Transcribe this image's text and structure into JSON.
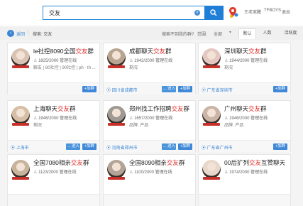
{
  "search": {
    "value": "交友",
    "clear": "×"
  },
  "user": {
    "name": "王老実騰",
    "tag": "TFBOYS",
    "more": "退出"
  },
  "filterbar": {
    "back_label": "返回",
    "crumb_sep": "|",
    "crumb_text": "搜索: 交友",
    "not_found": "搜索不到我的群?",
    "scope_label": "范围:",
    "scope_value": "全部",
    "scope_caret": "▾",
    "tabs": [
      "默认",
      "人数",
      "活跃度"
    ]
  },
  "cards": [
    {
      "title_pre": "le社控8090全国",
      "title_hl": "交友",
      "title_post": "群",
      "stats": "1825/2000  管理在线",
      "tags": "聊友 | 80社控 | 90社控 | ph · th ...",
      "location": "",
      "enter": "",
      "join": "+加群",
      "avatar_color": "#d9c3b3"
    },
    {
      "title_pre": "成都聊天",
      "title_hl": "交友",
      "title_post": "群",
      "stats": "1942/2000  管理在线",
      "tags": "剩况",
      "location": "四川省成都市",
      "enter": "→ 进入",
      "join": "+加群",
      "avatar_color": "#b7a592"
    },
    {
      "title_pre": "深圳聊天",
      "title_hl": "交友",
      "title_post": "群",
      "stats": "1944/2000  管理在线",
      "tags": "剩况",
      "location": "广东省深圳市",
      "enter": "",
      "join": "+加群",
      "avatar_color": "#e3c7c0"
    },
    {
      "title_pre": "上海聊天",
      "title_hl": "交友",
      "title_post": "群",
      "stats": "1946/2000  管理在线",
      "tags": "剩况",
      "location": "上海市",
      "enter": "→ 进入",
      "join": "+加群",
      "avatar_color": "#d7bfa6"
    },
    {
      "title_pre": "郑州找工作招聘",
      "title_hl": "交友",
      "title_post": "群",
      "stats": "1657/2000  管理在线",
      "tags": "品牌, 产品",
      "location": "河南省郑州市",
      "enter": "→ 进入",
      "join": "+加群",
      "avatar_color": "#9e9993"
    },
    {
      "title_pre": "广州聊天",
      "title_hl": "交友",
      "title_post": "群",
      "stats": "1946/2000  管理在线",
      "tags": "品牌, 产品",
      "location": "广东省广州市",
      "enter": "",
      "join": "+加群",
      "avatar_color": "#c9b4a5"
    },
    {
      "title_pre": "全国7080相亲",
      "title_hl": "交友",
      "title_post": "群",
      "stats": "1123/2000  管理在线",
      "tags": "",
      "location": "",
      "enter": "",
      "join": "",
      "avatar_color": "#c8b39d"
    },
    {
      "title_pre": "全国8090相亲",
      "title_hl": "交友",
      "title_post": "群",
      "stats": "1100/2000  管理在线",
      "tags": "",
      "location": "",
      "enter": "",
      "join": "",
      "avatar_color": "#b3a497"
    },
    {
      "title_pre": "00后扩列",
      "title_hl": "交友",
      "title_post": "互赞聊天",
      "stats": "1974/2000  管理在线",
      "tags": "",
      "location": "",
      "enter": "",
      "join": "",
      "avatar_color": "#e8d8cc"
    }
  ],
  "colors": {
    "accent": "#1f7fd6",
    "highlight": "#e0312c"
  },
  "icons": {
    "clear": "clear-icon",
    "search": "search-icon",
    "map_pin": "map-pin-icon",
    "back": "back-arrow-icon",
    "location": "location-pin-icon"
  }
}
